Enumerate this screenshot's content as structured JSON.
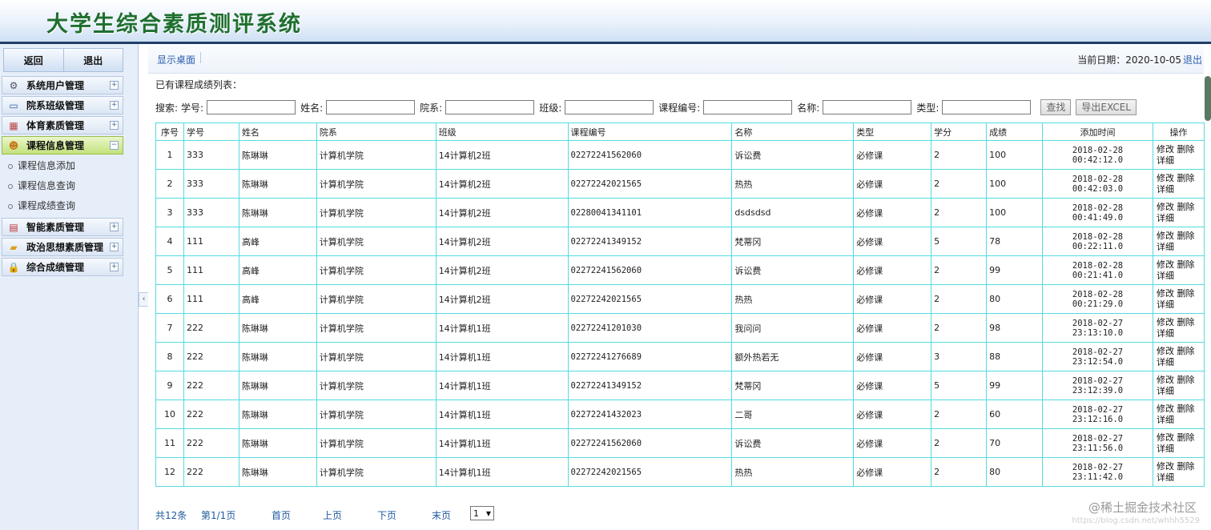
{
  "header": {
    "title": "大学生综合素质测评系统"
  },
  "sidebar": {
    "top_buttons": [
      "返回",
      "退出"
    ],
    "menu": [
      {
        "label": "系统用户管理",
        "icon": "gear-icon",
        "toggle": "+"
      },
      {
        "label": "院系班级管理",
        "icon": "monitor-icon",
        "toggle": "+"
      },
      {
        "label": "体育素质管理",
        "icon": "table-icon",
        "toggle": "+"
      },
      {
        "label": "课程信息管理",
        "icon": "user-icon",
        "toggle": "−",
        "active": true,
        "children": [
          "课程信息添加",
          "课程信息查询",
          "课程成绩查询"
        ]
      },
      {
        "label": "智能素质管理",
        "icon": "calendar-icon",
        "toggle": "+"
      },
      {
        "label": "政治思想素质管理",
        "icon": "folder-icon",
        "toggle": "+"
      },
      {
        "label": "综合成绩管理",
        "icon": "lock-icon",
        "toggle": "+"
      }
    ]
  },
  "topline": {
    "desktop_link": "显示桌面",
    "date_text": "当前日期：2020-10-05",
    "logout": "退出"
  },
  "list_title": "已有课程成绩列表：",
  "search": {
    "prefix": "搜索:",
    "fields": [
      "学号:",
      "姓名:",
      "院系:",
      "班级:",
      "课程编号:",
      "名称:",
      "类型:"
    ],
    "find_button": "查找",
    "excel_button": "导出EXCEL"
  },
  "table": {
    "headers": [
      "序号",
      "学号",
      "姓名",
      "院系",
      "班级",
      "课程编号",
      "名称",
      "类型",
      "学分",
      "成绩",
      "添加时间",
      "操作"
    ],
    "ops": [
      "修改",
      "删除",
      "详细"
    ],
    "rows": [
      [
        "1",
        "333",
        "陈琳琳",
        "计算机学院",
        "14计算机2班",
        "02272241562060",
        "诉讼费",
        "必修课",
        "2",
        "100",
        "2018-02-28 00:42:12.0"
      ],
      [
        "2",
        "333",
        "陈琳琳",
        "计算机学院",
        "14计算机2班",
        "02272242021565",
        "热热",
        "必修课",
        "2",
        "100",
        "2018-02-28 00:42:03.0"
      ],
      [
        "3",
        "333",
        "陈琳琳",
        "计算机学院",
        "14计算机2班",
        "02280041341101",
        "dsdsdsd",
        "必修课",
        "2",
        "100",
        "2018-02-28 00:41:49.0"
      ],
      [
        "4",
        "111",
        "高峰",
        "计算机学院",
        "14计算机2班",
        "02272241349152",
        "梵蒂冈",
        "必修课",
        "5",
        "78",
        "2018-02-28 00:22:11.0"
      ],
      [
        "5",
        "111",
        "高峰",
        "计算机学院",
        "14计算机2班",
        "02272241562060",
        "诉讼费",
        "必修课",
        "2",
        "99",
        "2018-02-28 00:21:41.0"
      ],
      [
        "6",
        "111",
        "高峰",
        "计算机学院",
        "14计算机2班",
        "02272242021565",
        "热热",
        "必修课",
        "2",
        "80",
        "2018-02-28 00:21:29.0"
      ],
      [
        "7",
        "222",
        "陈琳琳",
        "计算机学院",
        "14计算机1班",
        "02272241201030",
        "我问问",
        "必修课",
        "2",
        "98",
        "2018-02-27 23:13:10.0"
      ],
      [
        "8",
        "222",
        "陈琳琳",
        "计算机学院",
        "14计算机1班",
        "02272241276689",
        "额外热若无",
        "必修课",
        "3",
        "88",
        "2018-02-27 23:12:54.0"
      ],
      [
        "9",
        "222",
        "陈琳琳",
        "计算机学院",
        "14计算机1班",
        "02272241349152",
        "梵蒂冈",
        "必修课",
        "5",
        "99",
        "2018-02-27 23:12:39.0"
      ],
      [
        "10",
        "222",
        "陈琳琳",
        "计算机学院",
        "14计算机1班",
        "02272241432023",
        "二哥",
        "必修课",
        "2",
        "60",
        "2018-02-27 23:12:16.0"
      ],
      [
        "11",
        "222",
        "陈琳琳",
        "计算机学院",
        "14计算机1班",
        "02272241562060",
        "诉讼费",
        "必修课",
        "2",
        "70",
        "2018-02-27 23:11:56.0"
      ],
      [
        "12",
        "222",
        "陈琳琳",
        "计算机学院",
        "14计算机1班",
        "02272242021565",
        "热热",
        "必修课",
        "2",
        "80",
        "2018-02-27 23:11:42.0"
      ]
    ]
  },
  "pager": {
    "total": "共12条",
    "page": "第1/1页",
    "first": "首页",
    "prev": "上页",
    "next": "下页",
    "last": "末页",
    "select_value": "1"
  },
  "watermark": "@稀土掘金技术社区",
  "watermark_url": "https://blog.csdn.net/whhh5529"
}
